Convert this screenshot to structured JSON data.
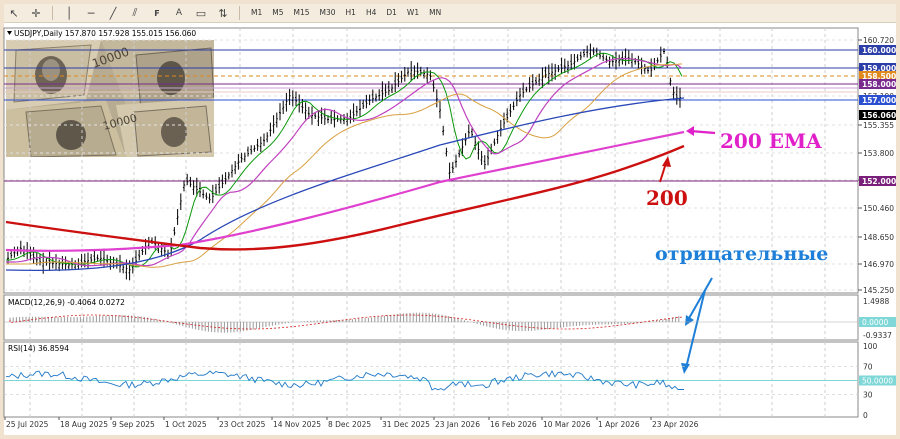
{
  "toolbar": {
    "timeframes": [
      "M1",
      "M5",
      "M15",
      "M30",
      "H1",
      "H4",
      "D1",
      "W1",
      "MN"
    ]
  },
  "chart_header": {
    "title": "USDJPY,Daily  157.870 157.928 155.015 156.060"
  },
  "price_axis": {
    "ticks": [
      "160.720",
      "158.955",
      "157.190",
      "155.355",
      "153.800",
      "152.035",
      "150.460",
      "148.650",
      "146.970",
      "145.250"
    ],
    "level_labels": [
      {
        "text": "160.000",
        "bg": "#2c3ea8"
      },
      {
        "text": "159.000",
        "bg": "#2c3ea8"
      },
      {
        "text": "158.500",
        "bg": "#e08a1e"
      },
      {
        "text": "158.000",
        "bg": "#7a2a8f"
      },
      {
        "text": "157.000",
        "bg": "#2b4fd1"
      },
      {
        "text": "156.060",
        "bg": "#000000"
      },
      {
        "text": "152.000",
        "bg": "#7a1f7a"
      }
    ]
  },
  "annotations": {
    "ema_label": "200 EMA",
    "sma_label": "200",
    "negative_label": "отрицательные"
  },
  "macd": {
    "title": "MACD(12,26,9) -0.4064 0.0272",
    "ticks": [
      "1.4988",
      "0.0000",
      "-0.9337"
    ]
  },
  "rsi": {
    "title": "RSI(14) 36.8594",
    "ticks": [
      "100",
      "70",
      "50.0000",
      "30",
      "0"
    ]
  },
  "time_axis": {
    "labels": [
      "25 Jul 2025",
      "18 Aug 2025",
      "9 Sep 2025",
      "1 Oct 2025",
      "23 Oct 2025",
      "14 Nov 2025",
      "8 Dec 2025",
      "31 Dec 2025",
      "23 Jan 2026",
      "16 Feb 2026",
      "10 Mar 2026",
      "1 Apr 2026",
      "23 Apr 2026"
    ]
  },
  "colors": {
    "ema200": "#e040d0",
    "sma200": "#cc1010",
    "arrow_blue": "#1e7fd8",
    "annotation_magenta": "#e020c8"
  }
}
